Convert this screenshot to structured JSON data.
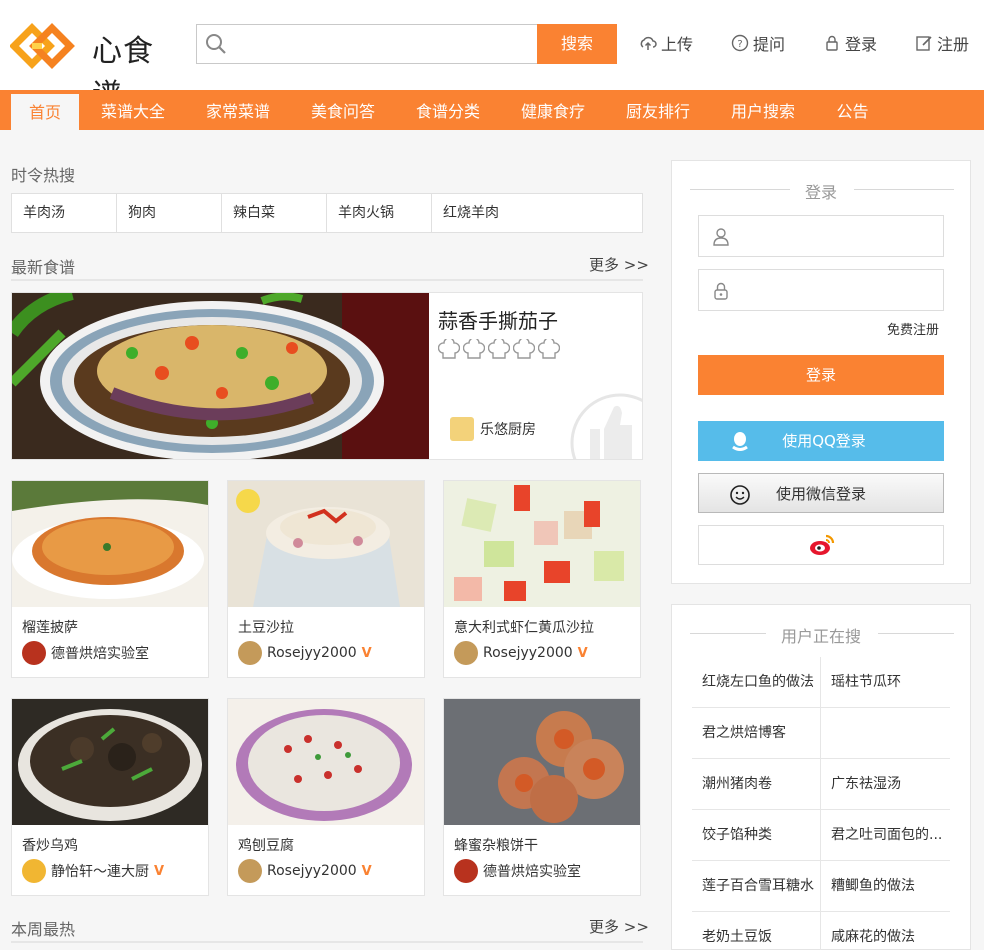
{
  "header": {
    "logo_text": "心食谱",
    "search": {
      "placeholder": "",
      "button_label": "搜索"
    },
    "links": {
      "upload": "上传",
      "ask": "提问",
      "login": "登录",
      "register": "注册"
    }
  },
  "nav": {
    "items": [
      "首页",
      "菜谱大全",
      "家常菜谱",
      "美食问答",
      "食谱分类",
      "健康食疗",
      "厨友排行",
      "用户搜索",
      "公告"
    ],
    "active_index": 0
  },
  "hot_search": {
    "title": "时令热搜",
    "items": [
      "羊肉汤",
      "狗肉",
      "辣白菜",
      "羊肉火锅",
      "红烧羊肉"
    ]
  },
  "latest": {
    "title": "最新食谱",
    "more": "更多 >>",
    "featured": {
      "title": "蒜香手撕茄子",
      "rating": 0,
      "rating_max": 5,
      "author": "乐悠厨房"
    },
    "cards": [
      {
        "title": "榴莲披萨",
        "author": "德普烘焙实验室",
        "verified": false
      },
      {
        "title": "土豆沙拉",
        "author": "Rosejyy2000",
        "verified": true
      },
      {
        "title": "意大利式虾仁黄瓜沙拉",
        "author": "Rosejyy2000",
        "verified": true
      },
      {
        "title": "香炒乌鸡",
        "author": "静怡轩～連大厨",
        "verified": true
      },
      {
        "title": "鸡刨豆腐",
        "author": "Rosejyy2000",
        "verified": true
      },
      {
        "title": "蜂蜜杂粮饼干",
        "author": "德普烘焙实验室",
        "verified": false
      }
    ]
  },
  "weekly": {
    "title": "本周最热",
    "more": "更多 >>"
  },
  "login_panel": {
    "heading": "登录",
    "username_placeholder": "",
    "password_placeholder": "",
    "free_register": "免费注册",
    "login_button": "登录",
    "qq_button": "使用QQ登录",
    "wechat_button": "使用微信登录",
    "colors": {
      "accent": "#fa8232",
      "qq": "#56bcea",
      "weibo": "#e6162d"
    }
  },
  "user_searching": {
    "heading": "用户正在搜",
    "rows": [
      [
        "红烧左口鱼的做法",
        "瑶柱节瓜环"
      ],
      [
        "君之烘焙博客",
        ""
      ],
      [
        "潮州猪肉卷",
        "广东祛湿汤"
      ],
      [
        "饺子馅种类",
        "君之吐司面包的..."
      ],
      [
        "莲子百合雪耳糖水",
        "糟鲫鱼的做法"
      ],
      [
        "老奶土豆饭",
        "咸麻花的做法"
      ]
    ]
  }
}
